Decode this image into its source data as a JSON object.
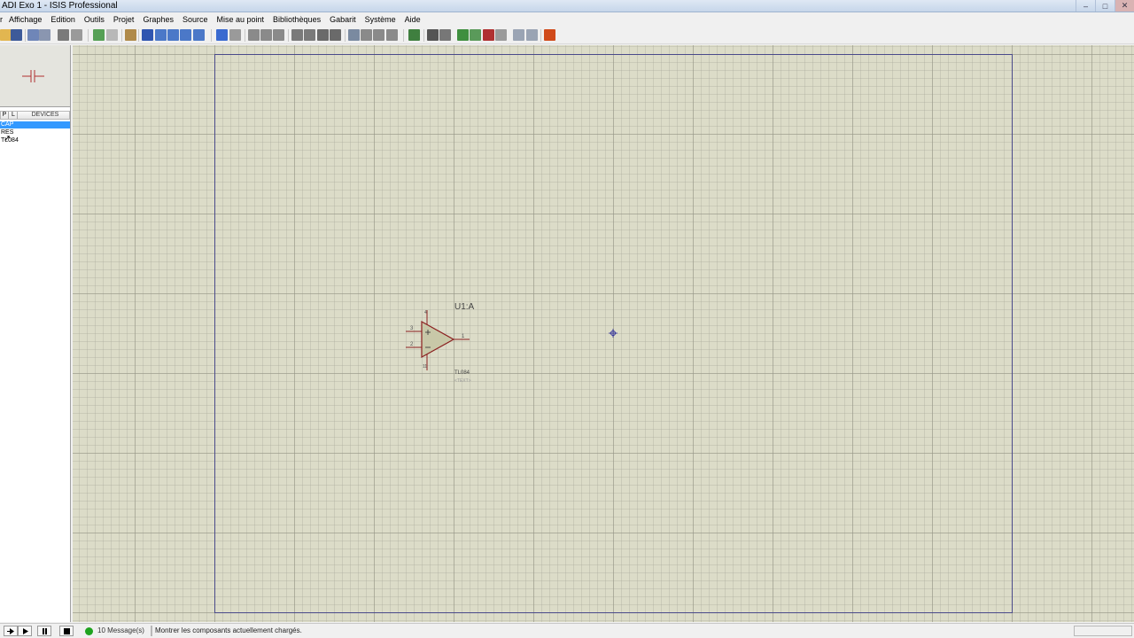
{
  "window": {
    "title": "ADI Exo 1 - ISIS Professional",
    "controls": [
      "–",
      "□",
      "✕"
    ]
  },
  "menu": [
    "r",
    "Affichage",
    "Edition",
    "Outils",
    "Projet",
    "Graphes",
    "Source",
    "Mise au point",
    "Bibliothèques",
    "Gabarit",
    "Système",
    "Aide"
  ],
  "devices": {
    "picker_p": "P",
    "picker_l": "L",
    "title": "DEVICES",
    "items": [
      "CAP",
      "RES",
      "TL084"
    ]
  },
  "component": {
    "reference": "U1:A",
    "value": "TL084",
    "text": "<TEXT>",
    "pins": {
      "noninv": "3",
      "inv": "2",
      "out": "1",
      "vplus": "4",
      "vminus": "11"
    }
  },
  "statusbar": {
    "messages": "10 Message(s)",
    "hint": "Montrer les composants actuellement chargés."
  },
  "colors": {
    "canvas": "#dcdcc8",
    "sheet_border": "#4a4a8a",
    "component_outline": "#8b2020",
    "selection": "#3399ff"
  }
}
